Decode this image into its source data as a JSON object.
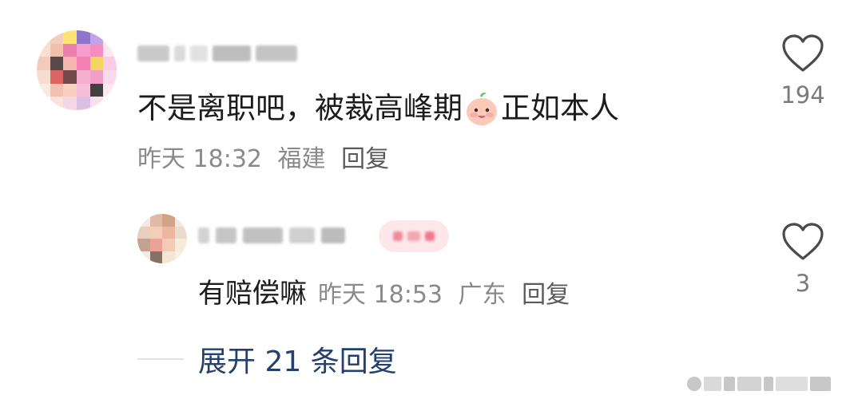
{
  "comment": {
    "text_before_emoji": "不是离职吧，被裁高峰期",
    "emoji_icon": "baby-face-emoji-icon",
    "text_after_emoji": "正如本人",
    "time": "昨天 18:32",
    "location": "福建",
    "reply_label": "回复",
    "like_count": "194"
  },
  "reply": {
    "text": "有赔偿嘛",
    "time": "昨天 18:53",
    "location": "广东",
    "reply_label": "回复",
    "like_count": "3"
  },
  "expand": {
    "label": "展开 21 条回复"
  },
  "colors": {
    "text_primary": "#1c1c1c",
    "text_meta": "#8a8a8a",
    "expand_link": "#23406e",
    "badge_bg": "#fde7ea"
  }
}
